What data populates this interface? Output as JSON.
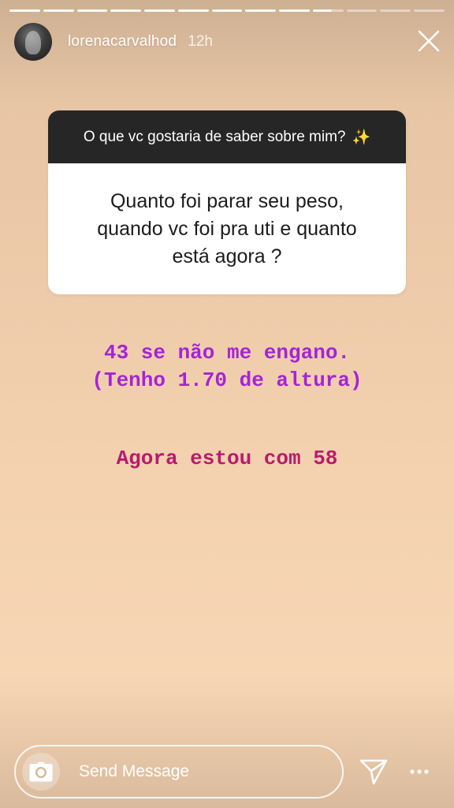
{
  "story": {
    "progress": {
      "segments": 13,
      "current_index": 9,
      "current_fraction": 0.6
    },
    "author": {
      "username": "lorenacarvalhod",
      "time_ago": "12h"
    },
    "question": {
      "prompt": "O que vc gostaria de saber sobre mim?",
      "prompt_emoji": "✨",
      "text": "Quanto foi parar seu peso,\nquando vc foi pra uti e quanto\nestá agora ?"
    },
    "answers": [
      {
        "text": "43 se não me engano.\n(Tenho 1.70 de altura)",
        "color": "#a424d6"
      },
      {
        "text": "Agora estou com 58",
        "color": "#b71b6f"
      }
    ]
  },
  "reply": {
    "placeholder": "Send Message"
  },
  "icons": {
    "close": "close-icon",
    "camera": "camera-icon",
    "send": "send-icon",
    "more": "more-icon"
  },
  "colors": {
    "background_top": "#e4c3a3",
    "background_bottom": "#f7d6b5",
    "question_header": "#262626"
  }
}
